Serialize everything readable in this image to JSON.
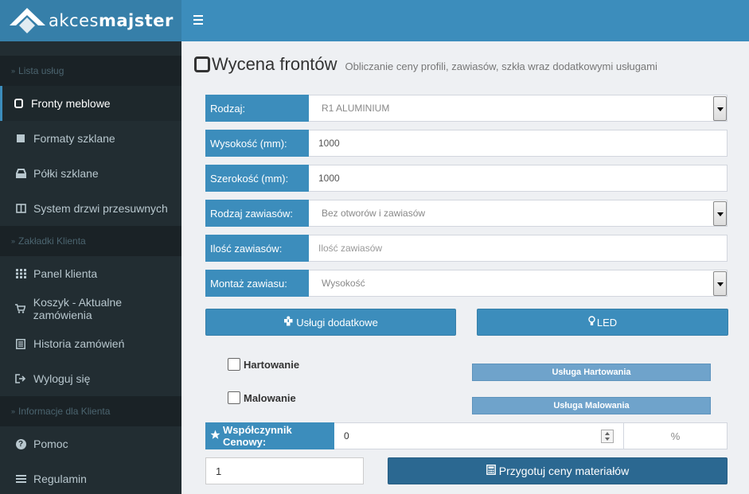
{
  "logo": {
    "text_light": "akces",
    "text_bold": "majster"
  },
  "sidebar": {
    "sections": [
      {
        "header": "Lista usług",
        "items": [
          {
            "label": "Fronty meblowe",
            "icon": "square-outline-icon",
            "active": true
          },
          {
            "label": "Formaty szklane",
            "icon": "square-icon"
          },
          {
            "label": "Półki szklane",
            "icon": "inbox-icon"
          },
          {
            "label": "System drzwi przesuwnych",
            "icon": "columns-icon"
          }
        ]
      },
      {
        "header": "Zakładki Klienta",
        "items": [
          {
            "label": "Panel klienta",
            "icon": "grid-icon"
          },
          {
            "label": "Koszyk - Aktualne zamówienia",
            "icon": "cart-icon"
          },
          {
            "label": "Historia zamówień",
            "icon": "list-alt-icon"
          },
          {
            "label": "Wyloguj się",
            "icon": "sign-out-icon"
          }
        ]
      },
      {
        "header": "Informacje dla Klienta",
        "items": [
          {
            "label": "Pomoc",
            "icon": "question-icon"
          },
          {
            "label": "Regulamin",
            "icon": "bars-icon"
          }
        ]
      }
    ]
  },
  "page": {
    "title": "Wycena frontów",
    "subtitle": "Obliczanie ceny profili, zawiasów, szkła wraz dodatkowymi usługami"
  },
  "form": {
    "rodzaj": {
      "label": "Rodzaj:",
      "value": "R1 ALUMINIUM"
    },
    "wysokosc": {
      "label": "Wysokość (mm):",
      "value": "1000"
    },
    "szerokosc": {
      "label": "Szerokość (mm):",
      "value": "1000"
    },
    "rodzaj_zawiasow": {
      "label": "Rodzaj zawiasów:",
      "value": "Bez otworów i zawiasów"
    },
    "ilosc_zawiasow": {
      "label": "Ilość zawiasów:",
      "placeholder": "Ilość zawiasów"
    },
    "montaz_zawiasu": {
      "label": "Montaż zawiasu:",
      "value": "Wysokość"
    }
  },
  "buttons": {
    "uslugi": "Usługi dodatkowe",
    "led": "LED",
    "hartowanie_service": "Usługa Hartowania",
    "malowanie_service": "Usługa Malowania",
    "przygotuj": "Przygotuj ceny materiałów"
  },
  "checkboxes": {
    "hartowanie": "Hartowanie",
    "malowanie": "Malowanie"
  },
  "coefficient": {
    "label": "Współczynnik Cenowy:",
    "value": "0",
    "unit": "%"
  },
  "quantity": {
    "value": "1"
  },
  "colors": {
    "primary": "#3c8dbc",
    "sidebar": "#222d32",
    "dark_button": "#2b6891"
  }
}
